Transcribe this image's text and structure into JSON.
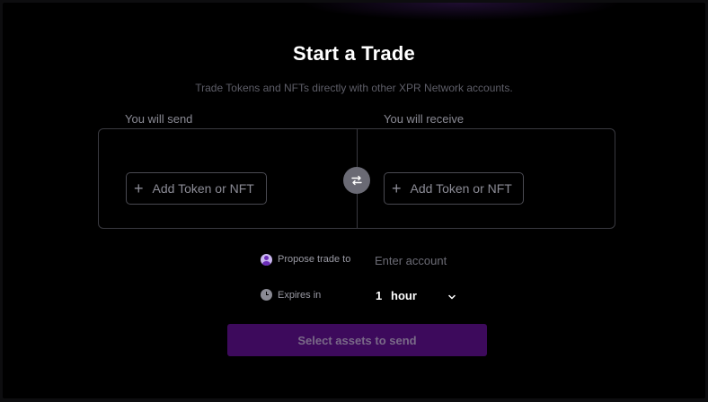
{
  "page": {
    "title": "Start a Trade",
    "subtitle": "Trade Tokens and NFTs directly with other XPR Network accounts."
  },
  "trade": {
    "send_label": "You will send",
    "receive_label": "You will receive",
    "add_send_label": "Add Token or NFT",
    "add_receive_label": "Add Token or NFT",
    "plus_symbol": "+",
    "swap_icon": "swap-arrows-icon"
  },
  "propose": {
    "label": "Propose trade to",
    "placeholder": "Enter account",
    "value": "",
    "icon": "user-avatar-icon"
  },
  "expires": {
    "label": "Expires in",
    "amount": "1",
    "unit": "hour",
    "icon": "clock-icon"
  },
  "submit": {
    "label": "Select assets to send"
  },
  "colors": {
    "background": "#000000",
    "accent": "#3d0a5c",
    "border": "#3a3a40",
    "muted_text": "#8a8a94"
  }
}
